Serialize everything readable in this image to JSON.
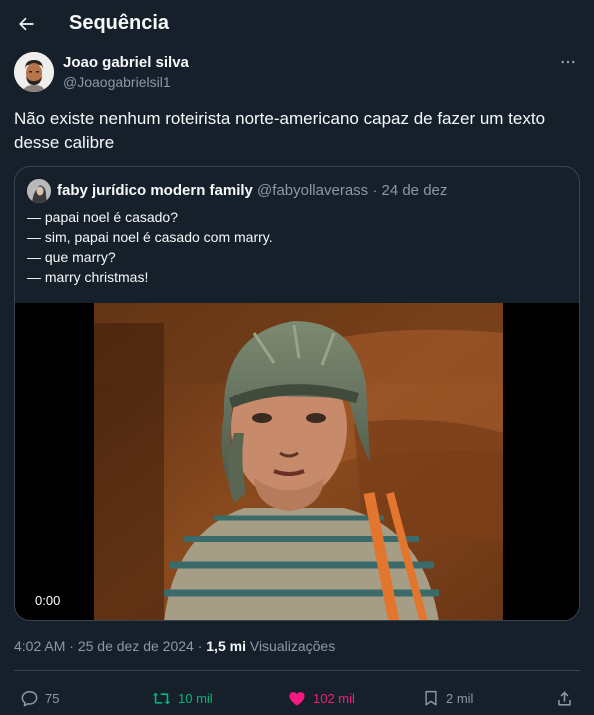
{
  "header": {
    "title": "Sequência"
  },
  "author": {
    "name": "Joao gabriel silva",
    "handle": "@Joaogabrielsil1"
  },
  "tweet": {
    "text": "Não existe nenhum roteirista norte-americano capaz de fazer um texto desse calibre"
  },
  "quote": {
    "name": "faby jurídico modern family",
    "handle": "@fabyollaverass",
    "date": "· 24 de dez",
    "lines": [
      "— papai noel é casado?",
      "— sim, papai noel é casado com marry.",
      "— que marry?",
      "— marry christmas!"
    ],
    "video_time": "0:00"
  },
  "meta": {
    "time": "4:02 AM",
    "date": "· 25 de dez de 2024 ·",
    "views_count": "1,5 mi",
    "views_label": "Visualizações"
  },
  "actions": {
    "replies": "75",
    "reposts": "10 mil",
    "likes": "102 mil",
    "bookmarks": "2 mil"
  },
  "colors": {
    "background": "#15202b",
    "border": "#38444d",
    "muted": "#8b98a5",
    "repost": "#00ba7c",
    "like": "#f91880"
  }
}
